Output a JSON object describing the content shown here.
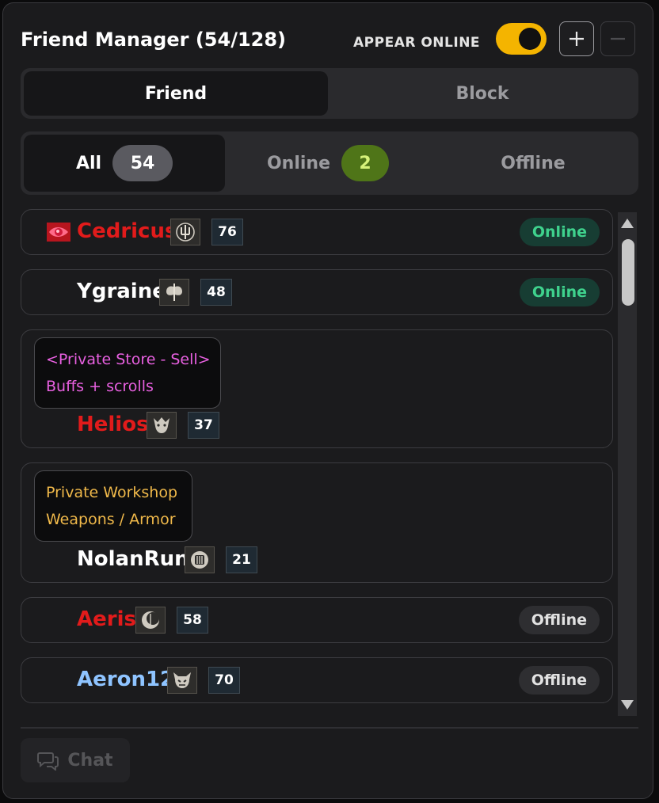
{
  "header": {
    "title": "Friend Manager (54/128)",
    "appear_online_label": "APPEAR ONLINE",
    "appear_online_on": true
  },
  "main_tabs": [
    {
      "label": "Friend",
      "active": true
    },
    {
      "label": "Block",
      "active": false
    }
  ],
  "filters": [
    {
      "label": "All",
      "count": "54",
      "active": true
    },
    {
      "label": "Online",
      "count": "2",
      "active": false
    },
    {
      "label": "Offline",
      "count": null,
      "active": false
    }
  ],
  "friends": [
    {
      "name": "Cedricus",
      "name_color": "#e21b1b",
      "class_icon": "trident-crest-icon",
      "level": "76",
      "status": "Online"
    },
    {
      "name": "Ygraine",
      "name_color": "#ffffff",
      "class_icon": "double-axe-icon",
      "level": "48",
      "status": "Online"
    },
    {
      "name": "Helios",
      "name_color": "#e21b1b",
      "class_icon": "beast-mask-icon",
      "level": "37",
      "status": "",
      "store_lines": [
        "<Private Store - Sell>",
        "Buffs + scrolls"
      ]
    },
    {
      "name": "NolanRun",
      "name_color": "#ffffff",
      "class_icon": "shield-crest-icon",
      "level": "21",
      "status": "",
      "store_lines": [
        "Private Workshop",
        "Weapons / Armor"
      ]
    },
    {
      "name": "Aeris",
      "name_color": "#e21b1b",
      "class_icon": "moon-crest-icon",
      "level": "58",
      "status": "Offline"
    },
    {
      "name": "Aeron12",
      "name_color": "#8fc4ff",
      "class_icon": "demon-crest-icon",
      "level": "70",
      "status": "Offline"
    }
  ],
  "footer": {
    "chat_label": "Chat"
  },
  "colors": {
    "accent": "#f4b400",
    "online_green": "#3fd28d",
    "hostile_red": "#e21b1b",
    "party_blue": "#8fc4ff"
  }
}
